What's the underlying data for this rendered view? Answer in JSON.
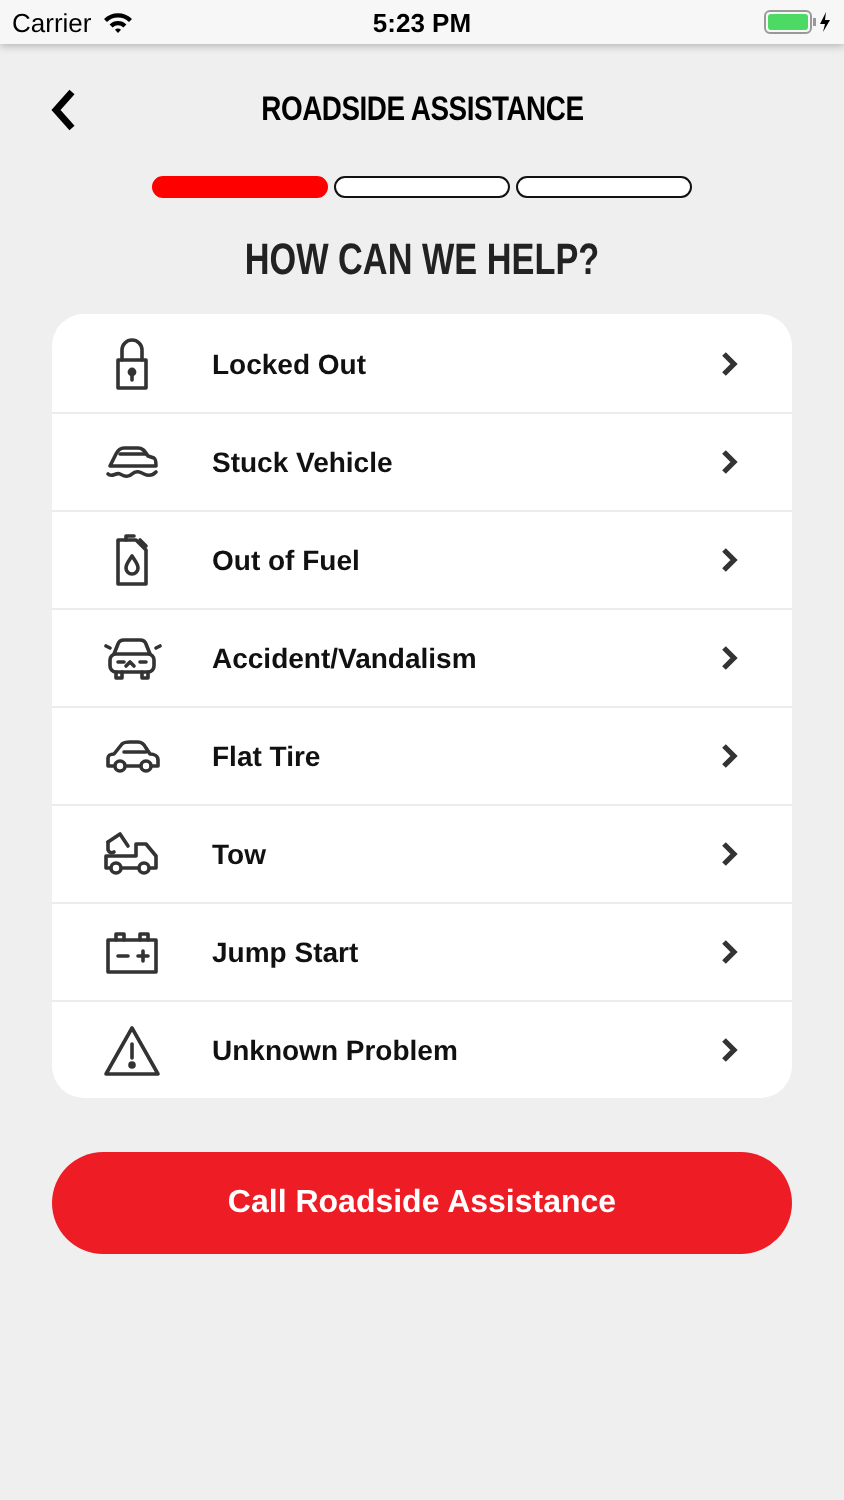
{
  "status_bar": {
    "carrier": "Carrier",
    "time": "5:23 PM"
  },
  "nav": {
    "title": "ROADSIDE ASSISTANCE"
  },
  "steps": [
    {
      "completed": true
    },
    {
      "completed": false
    },
    {
      "completed": false
    }
  ],
  "heading": "HOW CAN WE HELP?",
  "options": [
    {
      "kind": "lock",
      "label": "Locked Out"
    },
    {
      "kind": "flood",
      "label": "Stuck Vehicle"
    },
    {
      "kind": "fuel",
      "label": "Out of Fuel"
    },
    {
      "kind": "crash",
      "label": "Accident/Vandalism"
    },
    {
      "kind": "car",
      "label": "Flat Tire"
    },
    {
      "kind": "tow",
      "label": "Tow"
    },
    {
      "kind": "battery",
      "label": "Jump Start"
    },
    {
      "kind": "warning",
      "label": "Unknown Problem"
    }
  ],
  "call_button": "Call Roadside Assistance"
}
